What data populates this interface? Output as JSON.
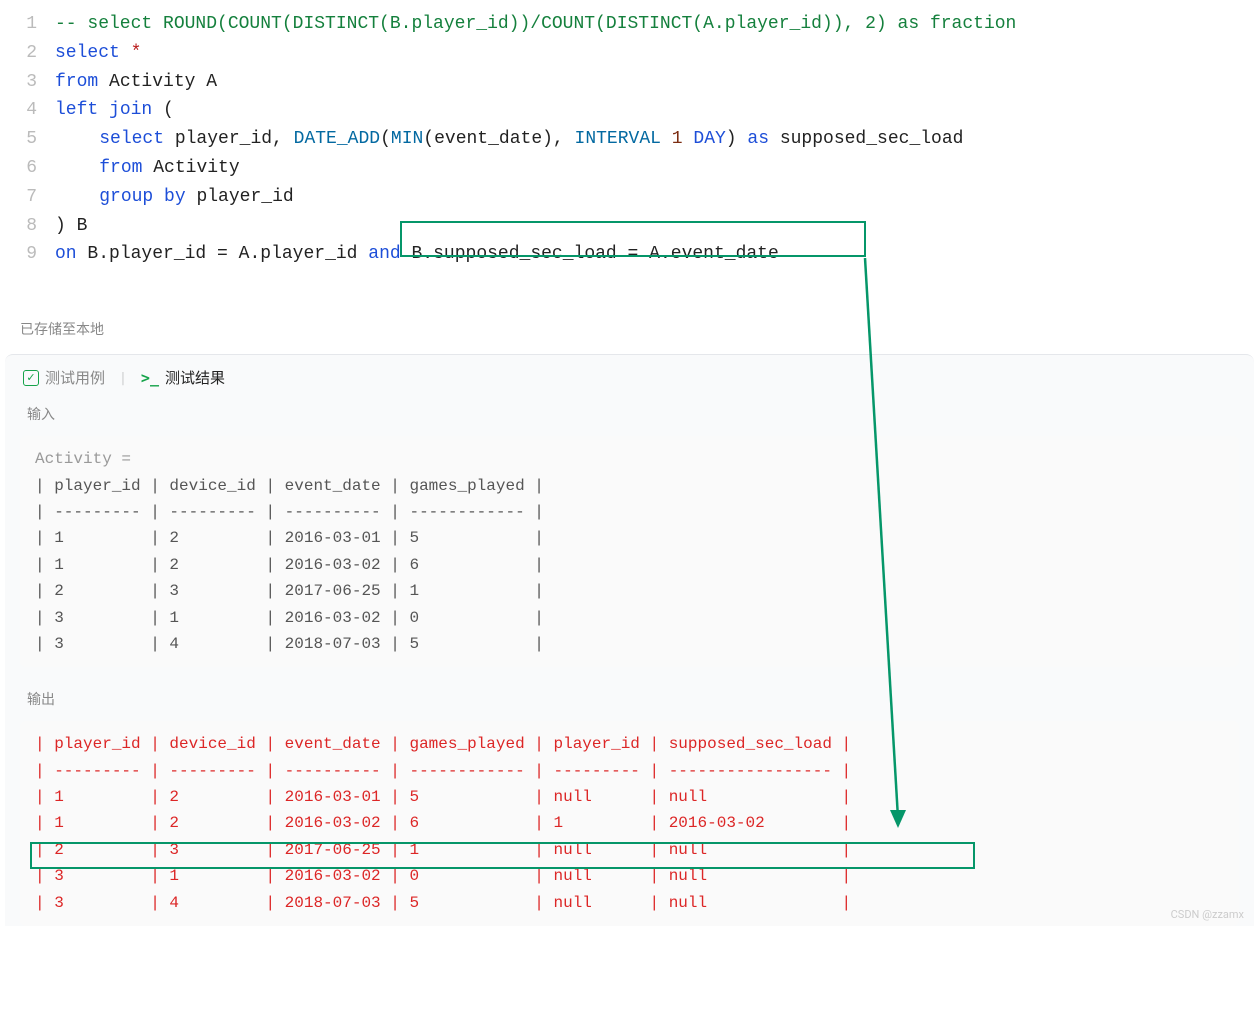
{
  "code": {
    "lines": [
      {
        "num": "1",
        "tokens": [
          [
            "comment",
            "-- select ROUND(COUNT(DISTINCT(B.player_id))/COUNT(DISTINCT(A.player_id)), 2) as fraction"
          ]
        ]
      },
      {
        "num": "2",
        "tokens": [
          [
            "keyword",
            "select"
          ],
          [
            "plain",
            " "
          ],
          [
            "star",
            "*"
          ]
        ]
      },
      {
        "num": "3",
        "tokens": [
          [
            "keyword",
            "from"
          ],
          [
            "plain",
            " Activity A"
          ]
        ]
      },
      {
        "num": "4",
        "tokens": [
          [
            "keyword",
            "left"
          ],
          [
            "plain",
            " "
          ],
          [
            "keyword",
            "join"
          ],
          [
            "plain",
            " ("
          ]
        ]
      },
      {
        "num": "5",
        "indent": true,
        "tokens": [
          [
            "plain",
            "    "
          ],
          [
            "keyword",
            "select"
          ],
          [
            "plain",
            " player_id, "
          ],
          [
            "func",
            "DATE_ADD"
          ],
          [
            "plain",
            "("
          ],
          [
            "func",
            "MIN"
          ],
          [
            "plain",
            "(event_date), "
          ],
          [
            "func",
            "INTERVAL"
          ],
          [
            "plain",
            " "
          ],
          [
            "num",
            "1"
          ],
          [
            "plain",
            " "
          ],
          [
            "keyword",
            "DAY"
          ],
          [
            "plain",
            ") "
          ],
          [
            "keyword",
            "as"
          ],
          [
            "plain",
            " supposed_sec_load"
          ]
        ]
      },
      {
        "num": "6",
        "indent": true,
        "tokens": [
          [
            "plain",
            "    "
          ],
          [
            "keyword",
            "from"
          ],
          [
            "plain",
            " Activity"
          ]
        ]
      },
      {
        "num": "7",
        "indent": true,
        "tokens": [
          [
            "plain",
            "    "
          ],
          [
            "keyword",
            "group"
          ],
          [
            "plain",
            " "
          ],
          [
            "keyword",
            "by"
          ],
          [
            "plain",
            " player_id"
          ]
        ]
      },
      {
        "num": "8",
        "tokens": [
          [
            "plain",
            ") B"
          ]
        ]
      },
      {
        "num": "9",
        "tokens": [
          [
            "keyword",
            "on"
          ],
          [
            "plain",
            " B.player_id "
          ],
          [
            "op",
            "="
          ],
          [
            "plain",
            " A.player_id "
          ],
          [
            "keyword",
            "and"
          ],
          [
            "plain",
            " B.supposed_sec_load "
          ],
          [
            "op",
            "="
          ],
          [
            "plain",
            " A.event_date"
          ]
        ]
      }
    ]
  },
  "status": {
    "save_msg": "已存储至本地"
  },
  "tabs": {
    "testcase_label": "测试用例",
    "result_label": "测试结果"
  },
  "sections": {
    "input_label": "输入",
    "output_label": "输出"
  },
  "input_block": {
    "title": "Activity =",
    "text": "| player_id | device_id | event_date | games_played |\n| --------- | --------- | ---------- | ------------ |\n| 1         | 2         | 2016-03-01 | 5            |\n| 1         | 2         | 2016-03-02 | 6            |\n| 2         | 3         | 2017-06-25 | 1            |\n| 3         | 1         | 2016-03-02 | 0            |\n| 3         | 4         | 2018-07-03 | 5            |"
  },
  "output_block": {
    "text": "| player_id | device_id | event_date | games_played | player_id | supposed_sec_load |\n| --------- | --------- | ---------- | ------------ | --------- | ----------------- |\n| 1         | 2         | 2016-03-01 | 5            | null      | null              |\n| 1         | 2         | 2016-03-02 | 6            | 1         | 2016-03-02        |\n| 2         | 3         | 2017-06-25 | 1            | null      | null              |\n| 3         | 1         | 2016-03-02 | 0            | null      | null              |\n| 3         | 4         | 2018-07-03 | 5            | null      | null              |"
  },
  "watermark": "CSDN @zzamx"
}
